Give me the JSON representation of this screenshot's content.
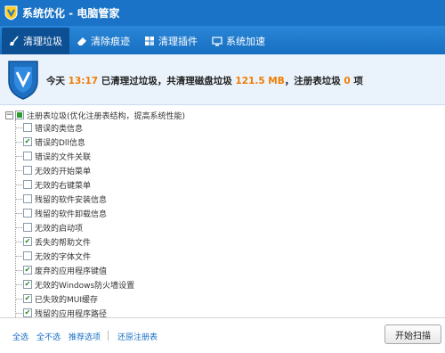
{
  "window": {
    "title": "系统优化 - 电脑管家"
  },
  "tabs": [
    {
      "label": "清理垃圾",
      "icon": "broom-icon",
      "active": true
    },
    {
      "label": "清除痕迹",
      "icon": "eraser-icon",
      "active": false
    },
    {
      "label": "清理插件",
      "icon": "plugin-icon",
      "active": false
    },
    {
      "label": "系统加速",
      "icon": "speedup-icon",
      "active": false
    }
  ],
  "summary": {
    "prefix": "今天",
    "time": "13:17",
    "middle": "已清理过垃圾，共清理磁盘垃圾",
    "disk_size": "121.5 MB",
    "registry_text": "，注册表垃圾",
    "registry_count": "0",
    "suffix": "项"
  },
  "tree": {
    "root_label": "注册表垃圾(优化注册表结构，提高系统性能)",
    "items": [
      {
        "label": "错误的类信息",
        "checked": false
      },
      {
        "label": "错误的Dll信息",
        "checked": true
      },
      {
        "label": "错误的文件关联",
        "checked": false
      },
      {
        "label": "无效的开始菜单",
        "checked": false
      },
      {
        "label": "无效的右键菜单",
        "checked": false
      },
      {
        "label": "残留的软件安装信息",
        "checked": false
      },
      {
        "label": "残留的软件卸载信息",
        "checked": false
      },
      {
        "label": "无效的启动项",
        "checked": false
      },
      {
        "label": "丢失的帮助文件",
        "checked": true
      },
      {
        "label": "无效的字体文件",
        "checked": false
      },
      {
        "label": "废弃的应用程序键值",
        "checked": true
      },
      {
        "label": "无效的Windows防火墙设置",
        "checked": true
      },
      {
        "label": "已失效的MUI缓存",
        "checked": true
      },
      {
        "label": "残留的应用程序路径",
        "checked": true
      }
    ]
  },
  "footer": {
    "select_all": "全选",
    "select_none": "全不选",
    "recommended": "推荐选项",
    "restore_registry": "还原注册表",
    "scan_button": "开始扫描"
  },
  "colors": {
    "titlebar": "#1a73c6",
    "accent": "#f07c00",
    "link": "#1a6fc4"
  }
}
